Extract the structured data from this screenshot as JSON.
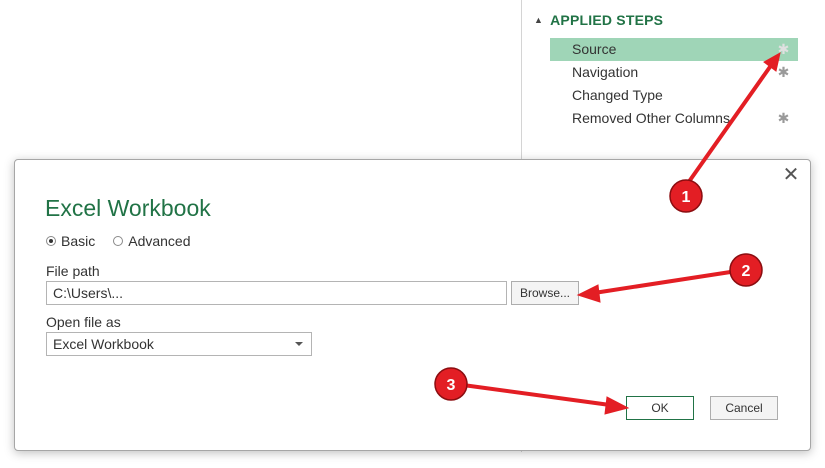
{
  "applied_steps": {
    "header": "APPLIED STEPS",
    "items": [
      {
        "label": "Source",
        "active": true,
        "has_gear": true
      },
      {
        "label": "Navigation",
        "active": false,
        "has_gear": true
      },
      {
        "label": "Changed Type",
        "active": false,
        "has_gear": false
      },
      {
        "label": "Removed Other Columns",
        "active": false,
        "has_gear": true
      }
    ]
  },
  "dialog": {
    "title": "Excel Workbook",
    "mode_options": [
      {
        "label": "Basic",
        "selected": true
      },
      {
        "label": "Advanced",
        "selected": false
      }
    ],
    "file_path_label": "File path",
    "file_path_value": "C:\\Users\\...",
    "browse_label": "Browse...",
    "open_as_label": "Open file as",
    "open_as_value": "Excel Workbook",
    "ok_label": "OK",
    "cancel_label": "Cancel"
  },
  "annotations": {
    "markers": [
      "1",
      "2",
      "3"
    ],
    "color": "#e31e24"
  },
  "colors": {
    "accent": "#217346",
    "active_step": "#9fd5b7"
  }
}
